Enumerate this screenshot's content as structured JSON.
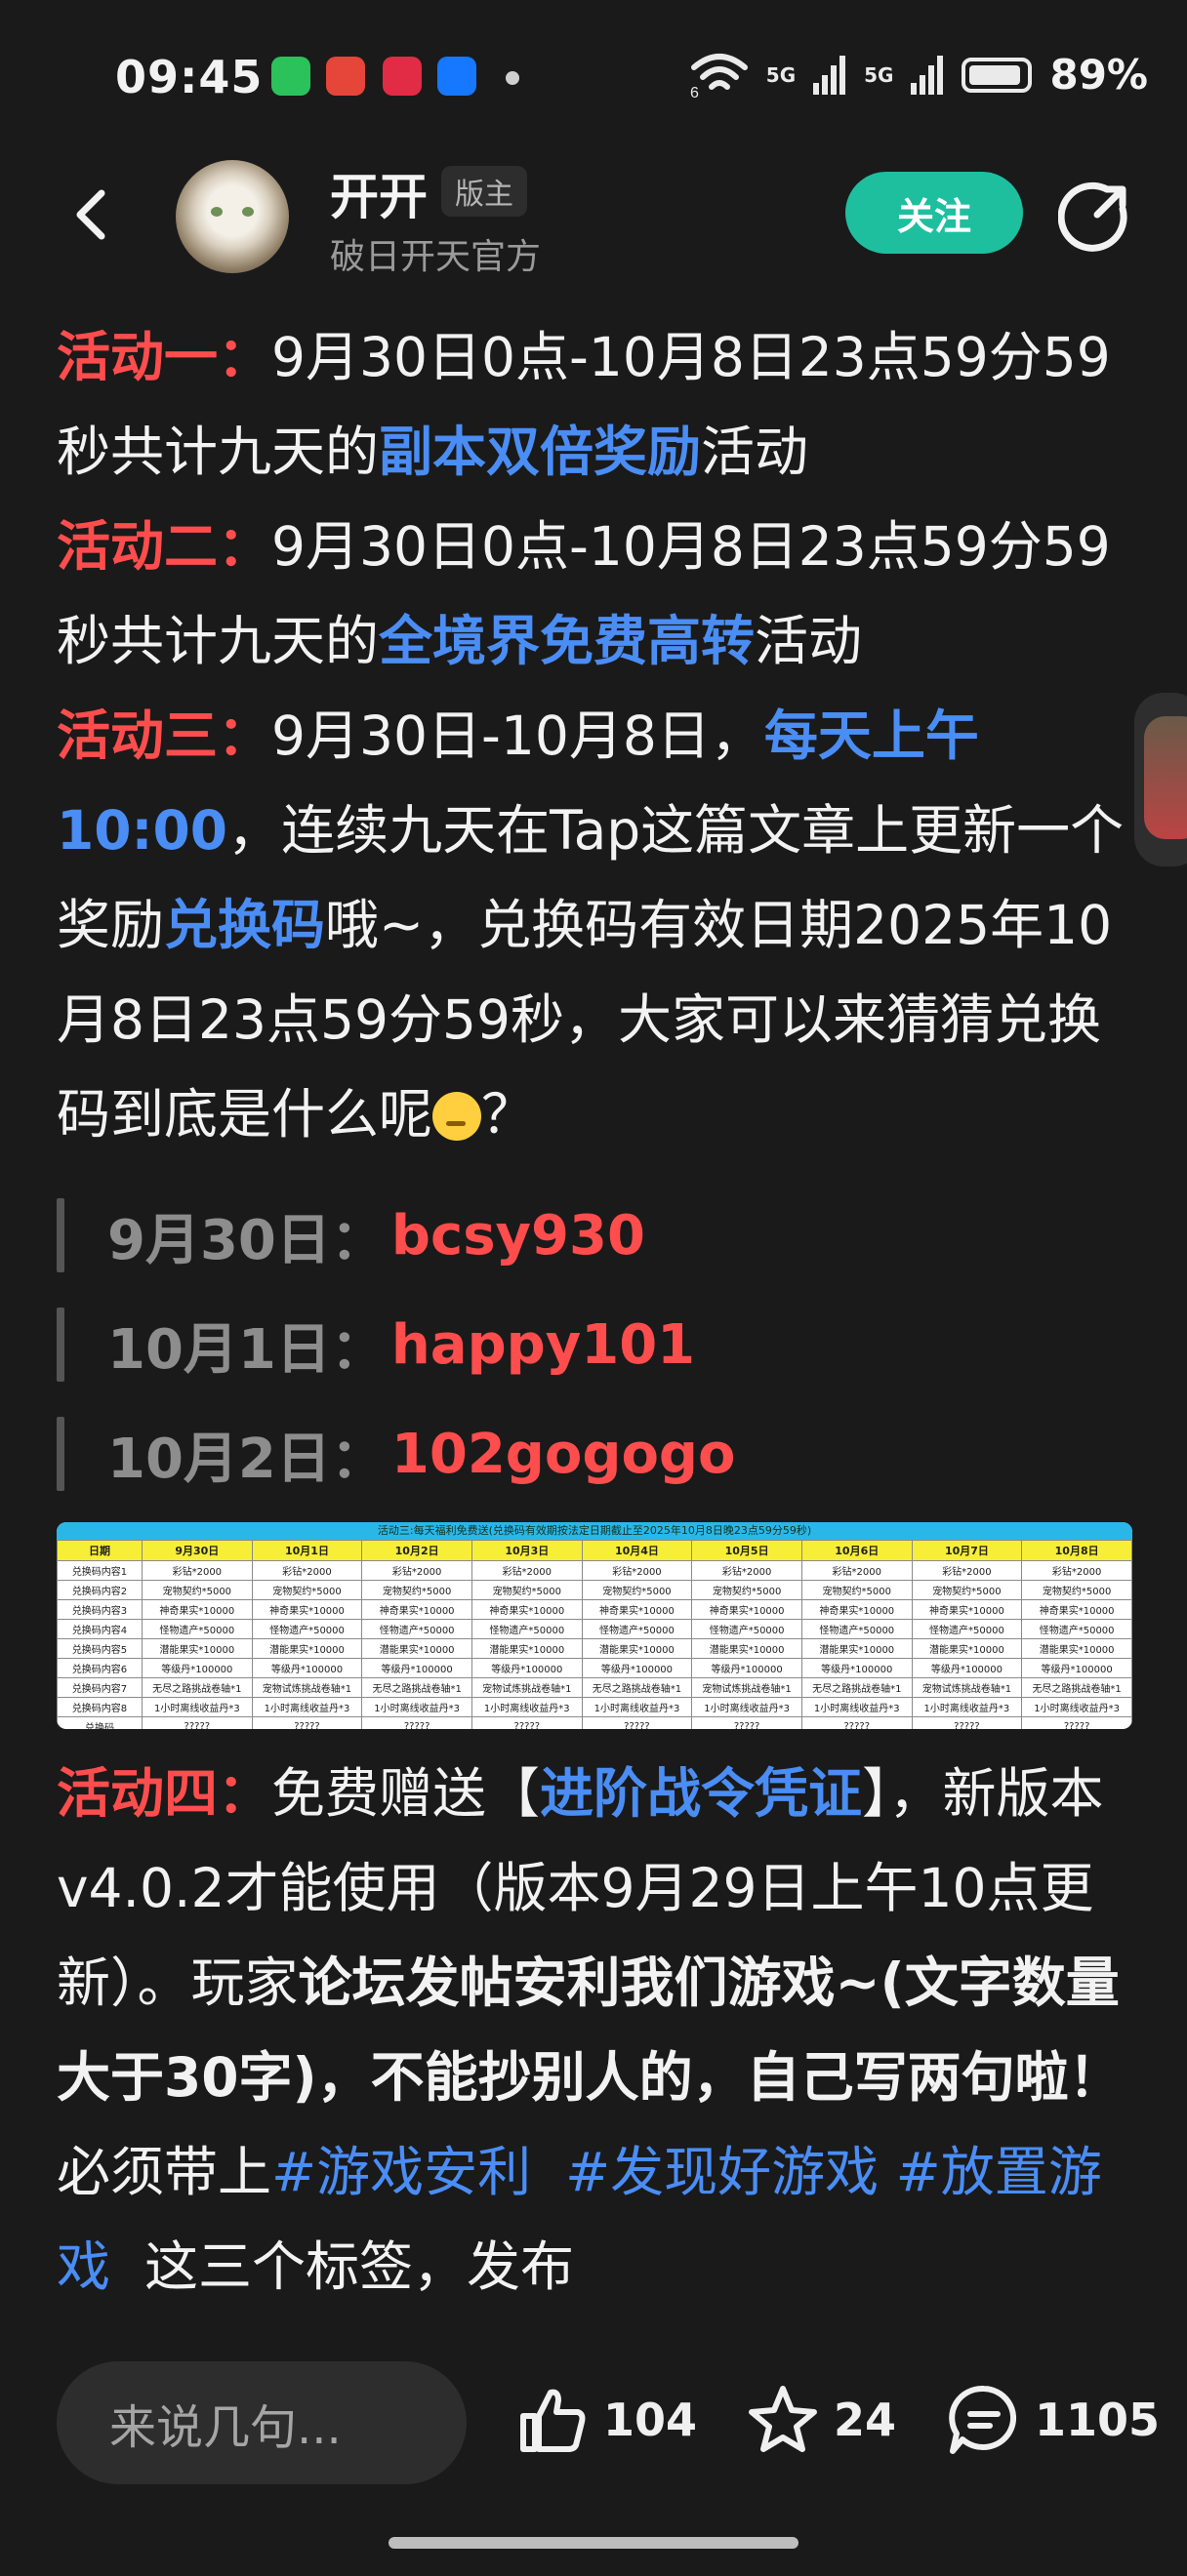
{
  "status_bar": {
    "time": "09:45",
    "net1": "5G",
    "net2": "5G",
    "sub6": "6",
    "battery": "89%"
  },
  "header": {
    "username": "开开",
    "badge": "版主",
    "subtitle": "破日开天官方",
    "follow_label": "关注"
  },
  "activity1": {
    "label": "活动一：",
    "text_a": "9月30日0点-10月8日23点59分59秒共计九天的",
    "highlight": "副本双倍奖励",
    "text_b": "活动"
  },
  "activity2": {
    "label": "活动二：",
    "text_a": "9月30日0点-10月8日23点59分59秒共计九天的",
    "highlight": "全境界免费高转",
    "text_b": "活动"
  },
  "activity3": {
    "label": "活动三：",
    "text_a": "9月30日-10月8日，",
    "highlight1": "每天上午10:00",
    "text_b": "，连续九天在Tap这篇文章上更新一个奖励",
    "highlight2": "兑换码",
    "text_c": "哦~，兑换码有效日期2025年10月8日23点59分59秒，大家可以来猜猜兑换码到底是什么呢",
    "text_d": "？"
  },
  "codes": [
    {
      "date": "9月30日：",
      "code": "bcsy930"
    },
    {
      "date": "10月1日：",
      "code": "happy101"
    },
    {
      "date": "10月2日：",
      "code": "102gogogo"
    }
  ],
  "reward_table": {
    "title": "活动三:每天福利免费送(兑换码有效期按法定日期截止至2025年10月8日晚23点59分59秒)",
    "headers": [
      "日期",
      "9月30日",
      "10月1日",
      "10月2日",
      "10月3日",
      "10月4日",
      "10月5日",
      "10月6日",
      "10月7日",
      "10月8日"
    ],
    "rows": [
      [
        "兑换码内容1",
        "彩钻*2000",
        "彩钻*2000",
        "彩钻*2000",
        "彩钻*2000",
        "彩钻*2000",
        "彩钻*2000",
        "彩钻*2000",
        "彩钻*2000",
        "彩钻*2000"
      ],
      [
        "兑换码内容2",
        "宠物契约*5000",
        "宠物契约*5000",
        "宠物契约*5000",
        "宠物契约*5000",
        "宠物契约*5000",
        "宠物契约*5000",
        "宠物契约*5000",
        "宠物契约*5000",
        "宠物契约*5000"
      ],
      [
        "兑换码内容3",
        "神奇果实*10000",
        "神奇果实*10000",
        "神奇果实*10000",
        "神奇果实*10000",
        "神奇果实*10000",
        "神奇果实*10000",
        "神奇果实*10000",
        "神奇果实*10000",
        "神奇果实*10000"
      ],
      [
        "兑换码内容4",
        "怪物遗产*50000",
        "怪物遗产*50000",
        "怪物遗产*50000",
        "怪物遗产*50000",
        "怪物遗产*50000",
        "怪物遗产*50000",
        "怪物遗产*50000",
        "怪物遗产*50000",
        "怪物遗产*50000"
      ],
      [
        "兑换码内容5",
        "潜能果实*10000",
        "潜能果实*10000",
        "潜能果实*10000",
        "潜能果实*10000",
        "潜能果实*10000",
        "潜能果实*10000",
        "潜能果实*10000",
        "潜能果实*10000",
        "潜能果实*10000"
      ],
      [
        "兑换码内容6",
        "等级丹*100000",
        "等级丹*100000",
        "等级丹*100000",
        "等级丹*100000",
        "等级丹*100000",
        "等级丹*100000",
        "等级丹*100000",
        "等级丹*100000",
        "等级丹*100000"
      ],
      [
        "兑换码内容7",
        "无尽之路挑战卷轴*1",
        "宠物试炼挑战卷轴*1",
        "无尽之路挑战卷轴*1",
        "宠物试炼挑战卷轴*1",
        "无尽之路挑战卷轴*1",
        "宠物试炼挑战卷轴*1",
        "无尽之路挑战卷轴*1",
        "宠物试炼挑战卷轴*1",
        "无尽之路挑战卷轴*1"
      ],
      [
        "兑换码内容8",
        "1小时离线收益丹*3",
        "1小时离线收益丹*3",
        "1小时离线收益丹*3",
        "1小时离线收益丹*3",
        "1小时离线收益丹*3",
        "1小时离线收益丹*3",
        "1小时离线收益丹*3",
        "1小时离线收益丹*3",
        "1小时离线收益丹*3"
      ],
      [
        "兑换码",
        "?????",
        "?????",
        "?????",
        "?????",
        "?????",
        "?????",
        "?????",
        "?????",
        "?????"
      ]
    ]
  },
  "activity4": {
    "label": "活动四：",
    "text_a": "免费赠送【",
    "highlight": "进阶战令凭证",
    "text_b": "】，新版本v4.0.2才能使用（版本9月29日上午10点更新）。玩家",
    "bold_text": "论坛发帖安利我们游戏~(文字数量大于30字)，不能抄别人的，自己写两句啦！",
    "text_c": "必须带上",
    "tag1": "#游戏安利",
    "tag2": "#发现好游戏",
    "tag3": "#放置游戏",
    "text_d": "这三个标签，发布"
  },
  "bottom_bar": {
    "comment_placeholder": "来说几句...",
    "likes": "104",
    "favorites": "24",
    "comments": "1105"
  },
  "colors": {
    "background": "#1a1a1a",
    "accent_red": "#ff4d4d",
    "accent_blue": "#4a8df5",
    "follow_green": "#1dbf9f"
  },
  "icons": [
    "back-arrow-icon",
    "share-icon",
    "thumb-up-icon",
    "star-icon",
    "comment-icon",
    "wifi-icon",
    "signal-icon",
    "battery-icon"
  ]
}
